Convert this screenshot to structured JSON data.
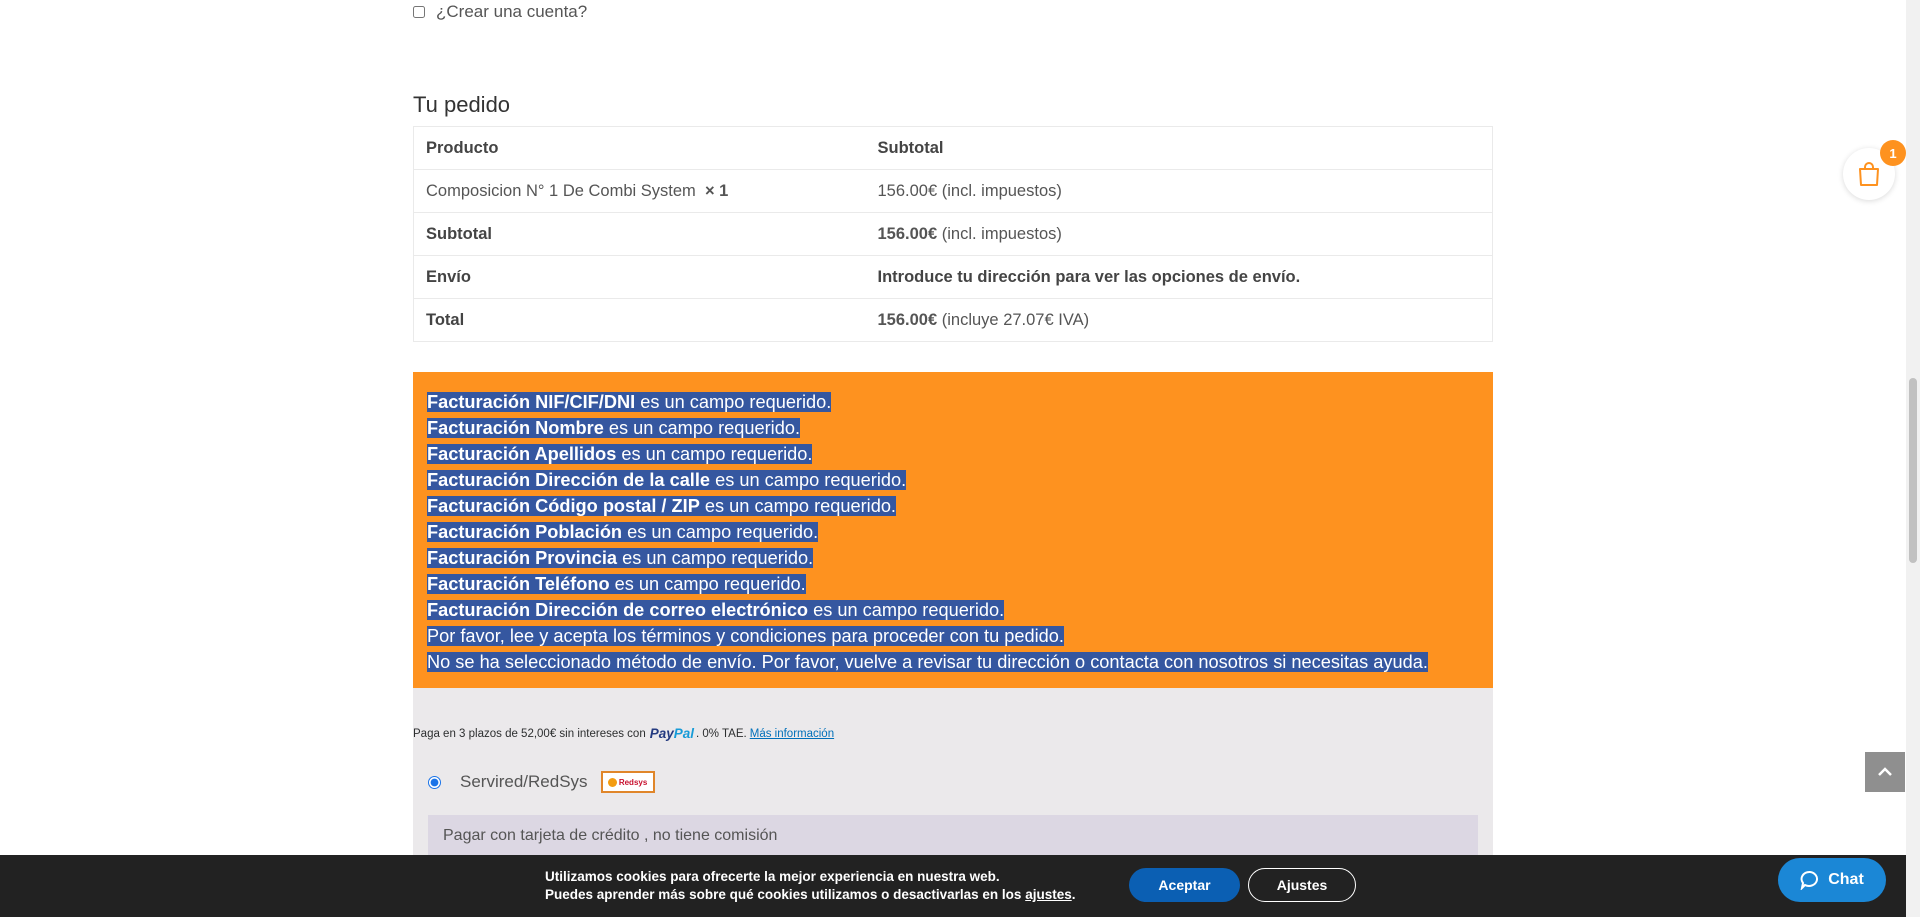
{
  "create_account": {
    "label": "¿Crear una cuenta?"
  },
  "order": {
    "title": "Tu pedido",
    "headers": {
      "product": "Producto",
      "subtotal": "Subtotal"
    },
    "item": {
      "name": "Composicion N° 1 De Combi System",
      "qty": "× 1",
      "price": "156.00€",
      "price_note": "(incl. impuestos)"
    },
    "subtotal": {
      "label": "Subtotal",
      "value": "156.00€",
      "note": "(incl. impuestos)"
    },
    "shipping": {
      "label": "Envío",
      "value": "Introduce tu dirección para ver las opciones de envío."
    },
    "total": {
      "label": "Total",
      "value": "156.00€",
      "note": "(incluye 27.07€ IVA)"
    }
  },
  "errors": [
    {
      "field": "Facturación NIF/CIF/DNI",
      "msg": " es un campo requerido."
    },
    {
      "field": "Facturación Nombre",
      "msg": " es un campo requerido."
    },
    {
      "field": "Facturación Apellidos",
      "msg": " es un campo requerido."
    },
    {
      "field": "Facturación Dirección de la calle",
      "msg": " es un campo requerido."
    },
    {
      "field": "Facturación Código postal / ZIP",
      "msg": " es un campo requerido."
    },
    {
      "field": "Facturación Población",
      "msg": " es un campo requerido."
    },
    {
      "field": "Facturación Provincia",
      "msg": " es un campo requerido."
    },
    {
      "field": "Facturación Teléfono",
      "msg": " es un campo requerido."
    },
    {
      "field": "Facturación Dirección de correo electrónico",
      "msg": " es un campo requerido."
    },
    {
      "field": "",
      "msg": "Por favor, lee y acepta los términos y condiciones para proceder con tu pedido."
    },
    {
      "field": "",
      "msg": "No se ha seleccionado método de envío. Por favor, vuelve a revisar tu dirección o contacta con nosotros si necesitas ayuda."
    }
  ],
  "paypal": {
    "message": "Paga en 3 plazos de 52,00€ sin intereses con",
    "logo_pay": "Pay",
    "logo_pal": "Pal",
    "tae": ". 0% TAE.",
    "link": "Más información"
  },
  "payment_method": {
    "label": "Servired/RedSys",
    "logo_text": "Redsys",
    "description": "Pagar con tarjeta de crédito , no tiene comisión"
  },
  "cookie": {
    "line1": "Utilizamos cookies para ofrecerte la mejor experiencia en nuestra web.",
    "line2": "Puedes aprender más sobre qué cookies utilizamos o desactivarlas en los",
    "link": "ajustes",
    "accept": "Aceptar",
    "settings": "Ajustes"
  },
  "cart": {
    "count": "1"
  },
  "chat": {
    "label": "Chat"
  },
  "colors": {
    "accent": "#fe921f",
    "selection": "#3557a0",
    "primary": "#0b5fb3",
    "chat": "#1b87d6"
  }
}
